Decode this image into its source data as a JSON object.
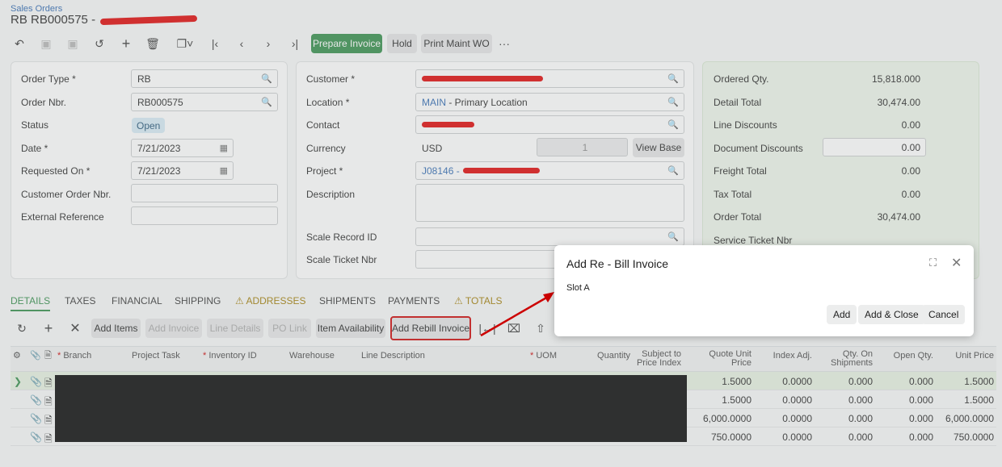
{
  "breadcrumb": "Sales Orders",
  "title": "RB RB000575 -",
  "toolbar": {
    "prepare_invoice": "Prepare Invoice",
    "hold": "Hold",
    "print_maint_wo": "Print Maint WO",
    "more": "···"
  },
  "left_panel": {
    "order_type_label": "Order Type *",
    "order_type": "RB",
    "order_nbr_label": "Order Nbr.",
    "order_nbr": "RB000575",
    "status_label": "Status",
    "status": "Open",
    "date_label": "Date *",
    "date": "7/21/2023",
    "requested_on_label": "Requested On *",
    "requested_on": "7/21/2023",
    "customer_order_nbr_label": "Customer Order Nbr.",
    "external_reference_label": "External Reference"
  },
  "mid_panel": {
    "customer_label": "Customer *",
    "location_label": "Location *",
    "location_code": "MAIN",
    "location_name": " - Primary Location",
    "contact_label": "Contact",
    "currency_label": "Currency",
    "currency": "USD",
    "rate": "1",
    "view_base": "View Base",
    "project_label": "Project *",
    "project": "J08146 -",
    "description_label": "Description",
    "scale_record_label": "Scale Record ID",
    "scale_ticket_label": "Scale Ticket Nbr"
  },
  "totals": {
    "ordered_qty_label": "Ordered Qty.",
    "ordered_qty": "15,818.000",
    "detail_total_label": "Detail Total",
    "detail_total": "30,474.00",
    "line_discounts_label": "Line Discounts",
    "line_discounts": "0.00",
    "document_discounts_label": "Document Discounts",
    "document_discounts": "0.00",
    "freight_total_label": "Freight Total",
    "freight_total": "0.00",
    "tax_total_label": "Tax Total",
    "tax_total": "0.00",
    "order_total_label": "Order Total",
    "order_total": "30,474.00",
    "service_ticket_label": "Service Ticket Nbr"
  },
  "tabs": [
    "DETAILS",
    "TAXES",
    "FINANCIAL",
    "SHIPPING",
    "ADDRESSES",
    "SHIPMENTS",
    "PAYMENTS",
    "TOTALS"
  ],
  "grid_toolbar": {
    "add_items": "Add Items",
    "add_invoice": "Add Invoice",
    "line_details": "Line Details",
    "po_link": "PO Link",
    "item_availability": "Item Availability",
    "add_rebill_invoice": "Add Rebill Invoice"
  },
  "grid_headers": {
    "branch": "Branch",
    "project_task": "Project Task",
    "inventory_id": "Inventory ID",
    "warehouse": "Warehouse",
    "line_description": "Line Description",
    "uom": "UOM",
    "quantity": "Quantity",
    "subject_to_price_index_1": "Subject to",
    "subject_to_price_index_2": "Price Index",
    "quote_unit_price_1": "Quote Unit",
    "quote_unit_price_2": "Price",
    "index_adj": "Index Adj.",
    "qty_on_shipments_1": "Qty. On",
    "qty_on_shipments_2": "Shipments",
    "open_qty": "Open Qty.",
    "unit_price": "Unit Price"
  },
  "rows": [
    {
      "quote": "1.5000",
      "index": "0.0000",
      "qtyship": "0.000",
      "open": "0.000",
      "unit": "1.5000"
    },
    {
      "quote": "1.5000",
      "index": "0.0000",
      "qtyship": "0.000",
      "open": "0.000",
      "unit": "1.5000"
    },
    {
      "quote": "6,000.0000",
      "index": "0.0000",
      "qtyship": "0.000",
      "open": "0.000",
      "unit": "6,000.0000"
    },
    {
      "quote": "750.0000",
      "index": "0.0000",
      "qtyship": "0.000",
      "open": "0.000",
      "unit": "750.0000"
    }
  ],
  "dialog": {
    "title": "Add Re - Bill Invoice",
    "slot": "Slot A",
    "add": "Add",
    "add_close": "Add & Close",
    "cancel": "Cancel"
  },
  "colors": {
    "primary_green": "#2e8b46",
    "annotation_red": "#cc0000"
  }
}
